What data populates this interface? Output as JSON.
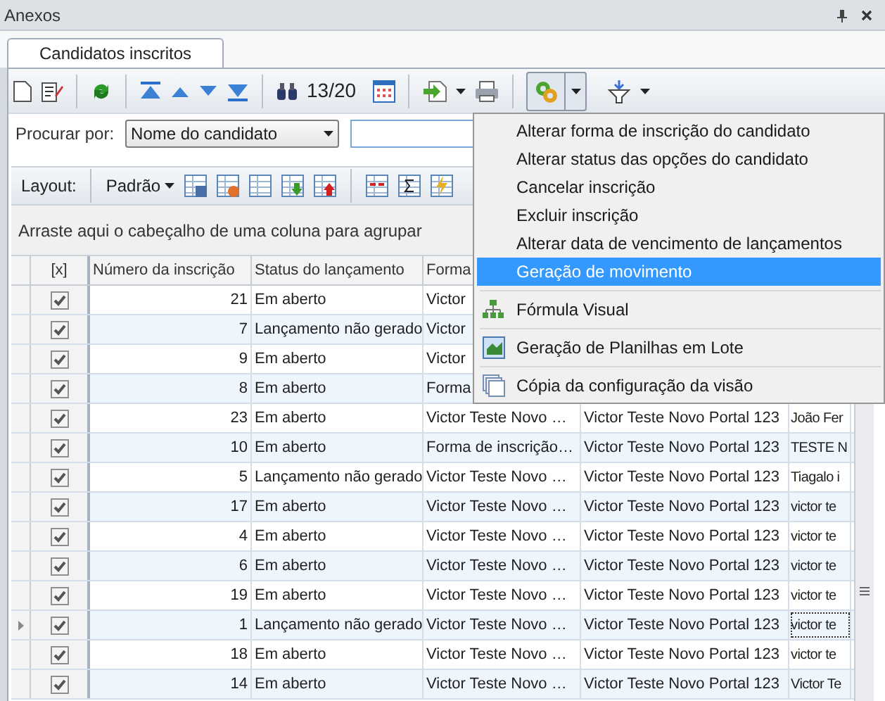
{
  "panel": {
    "title": "Anexos"
  },
  "tabs": [
    {
      "label": "Candidatos inscritos",
      "selected": true
    }
  ],
  "toolbar": {
    "record_counter": "13/20"
  },
  "search": {
    "label": "Procurar por:",
    "field": "Nome do candidato"
  },
  "layout_bar": {
    "label": "Layout:",
    "layout": "Padrão"
  },
  "group_panel": {
    "hint": "Arraste aqui o cabeçalho de uma coluna para agrupar"
  },
  "table": {
    "checkbox_header": "[x]",
    "columns": [
      "Número da inscrição",
      "Status do lançamento",
      "Forma"
    ],
    "rows": [
      {
        "current": false,
        "checked": true,
        "cells": [
          "21",
          "Em aberto",
          "Victor"
        ]
      },
      {
        "current": false,
        "checked": true,
        "cells": [
          "7",
          "Lançamento não gerado",
          "Victor"
        ]
      },
      {
        "current": false,
        "checked": true,
        "cells": [
          "9",
          "Em aberto",
          "Victor"
        ]
      },
      {
        "current": false,
        "checked": true,
        "cells": [
          "8",
          "Em aberto",
          "Forma"
        ]
      },
      {
        "current": false,
        "checked": true,
        "cells": [
          "23",
          "Em aberto",
          "Victor Teste Novo …",
          "Victor Teste Novo Portal 123",
          "João Fer"
        ]
      },
      {
        "current": false,
        "checked": true,
        "cells": [
          "10",
          "Em aberto",
          "Forma de inscrição…",
          "Victor Teste Novo Portal 123",
          "TESTE N"
        ]
      },
      {
        "current": false,
        "checked": true,
        "cells": [
          "5",
          "Lançamento não gerado",
          "Victor Teste Novo …",
          "Victor Teste Novo Portal 123",
          "Tiagalo i"
        ]
      },
      {
        "current": false,
        "checked": true,
        "cells": [
          "17",
          "Em aberto",
          "Victor Teste Novo …",
          "Victor Teste Novo Portal 123",
          "victor te"
        ]
      },
      {
        "current": false,
        "checked": true,
        "cells": [
          "4",
          "Em aberto",
          "Victor Teste Novo …",
          "Victor Teste Novo Portal 123",
          "victor te"
        ]
      },
      {
        "current": false,
        "checked": true,
        "cells": [
          "6",
          "Em aberto",
          "Victor Teste Novo …",
          "Victor Teste Novo Portal 123",
          "victor te"
        ]
      },
      {
        "current": false,
        "checked": true,
        "cells": [
          "19",
          "Em aberto",
          "Victor Teste Novo …",
          "Victor Teste Novo Portal 123",
          "victor te"
        ]
      },
      {
        "current": true,
        "checked": true,
        "cells": [
          "1",
          "Lançamento não gerado",
          "Victor Teste Novo …",
          "Victor Teste Novo Portal 123",
          "victor te"
        ]
      },
      {
        "current": false,
        "checked": true,
        "cells": [
          "18",
          "Em aberto",
          "Victor Teste Novo …",
          "Victor Teste Novo Portal 123",
          "victor te"
        ]
      },
      {
        "current": false,
        "checked": true,
        "cells": [
          "14",
          "Em aberto",
          "Victor Teste Novo …",
          "Victor Teste Novo Portal 123",
          "Victor Te"
        ]
      }
    ]
  },
  "menu": {
    "items": [
      {
        "kind": "plain",
        "label": "Alterar forma de inscrição do candidato",
        "selected": false
      },
      {
        "kind": "plain",
        "label": "Alterar status das opções do candidato",
        "selected": false
      },
      {
        "kind": "plain",
        "label": "Cancelar inscrição",
        "selected": false
      },
      {
        "kind": "plain",
        "label": "Excluir inscrição",
        "selected": false
      },
      {
        "kind": "plain",
        "label": "Alterar data de vencimento de lançamentos",
        "selected": false
      },
      {
        "kind": "plain",
        "label": "Geração de movimento",
        "selected": true
      },
      {
        "kind": "icon",
        "label": "Fórmula Visual",
        "selected": false
      },
      {
        "kind": "icon",
        "label": "Geração de Planilhas em Lote",
        "selected": false
      },
      {
        "kind": "icon",
        "label": "Cópia da configuração da visão",
        "selected": false
      }
    ]
  }
}
